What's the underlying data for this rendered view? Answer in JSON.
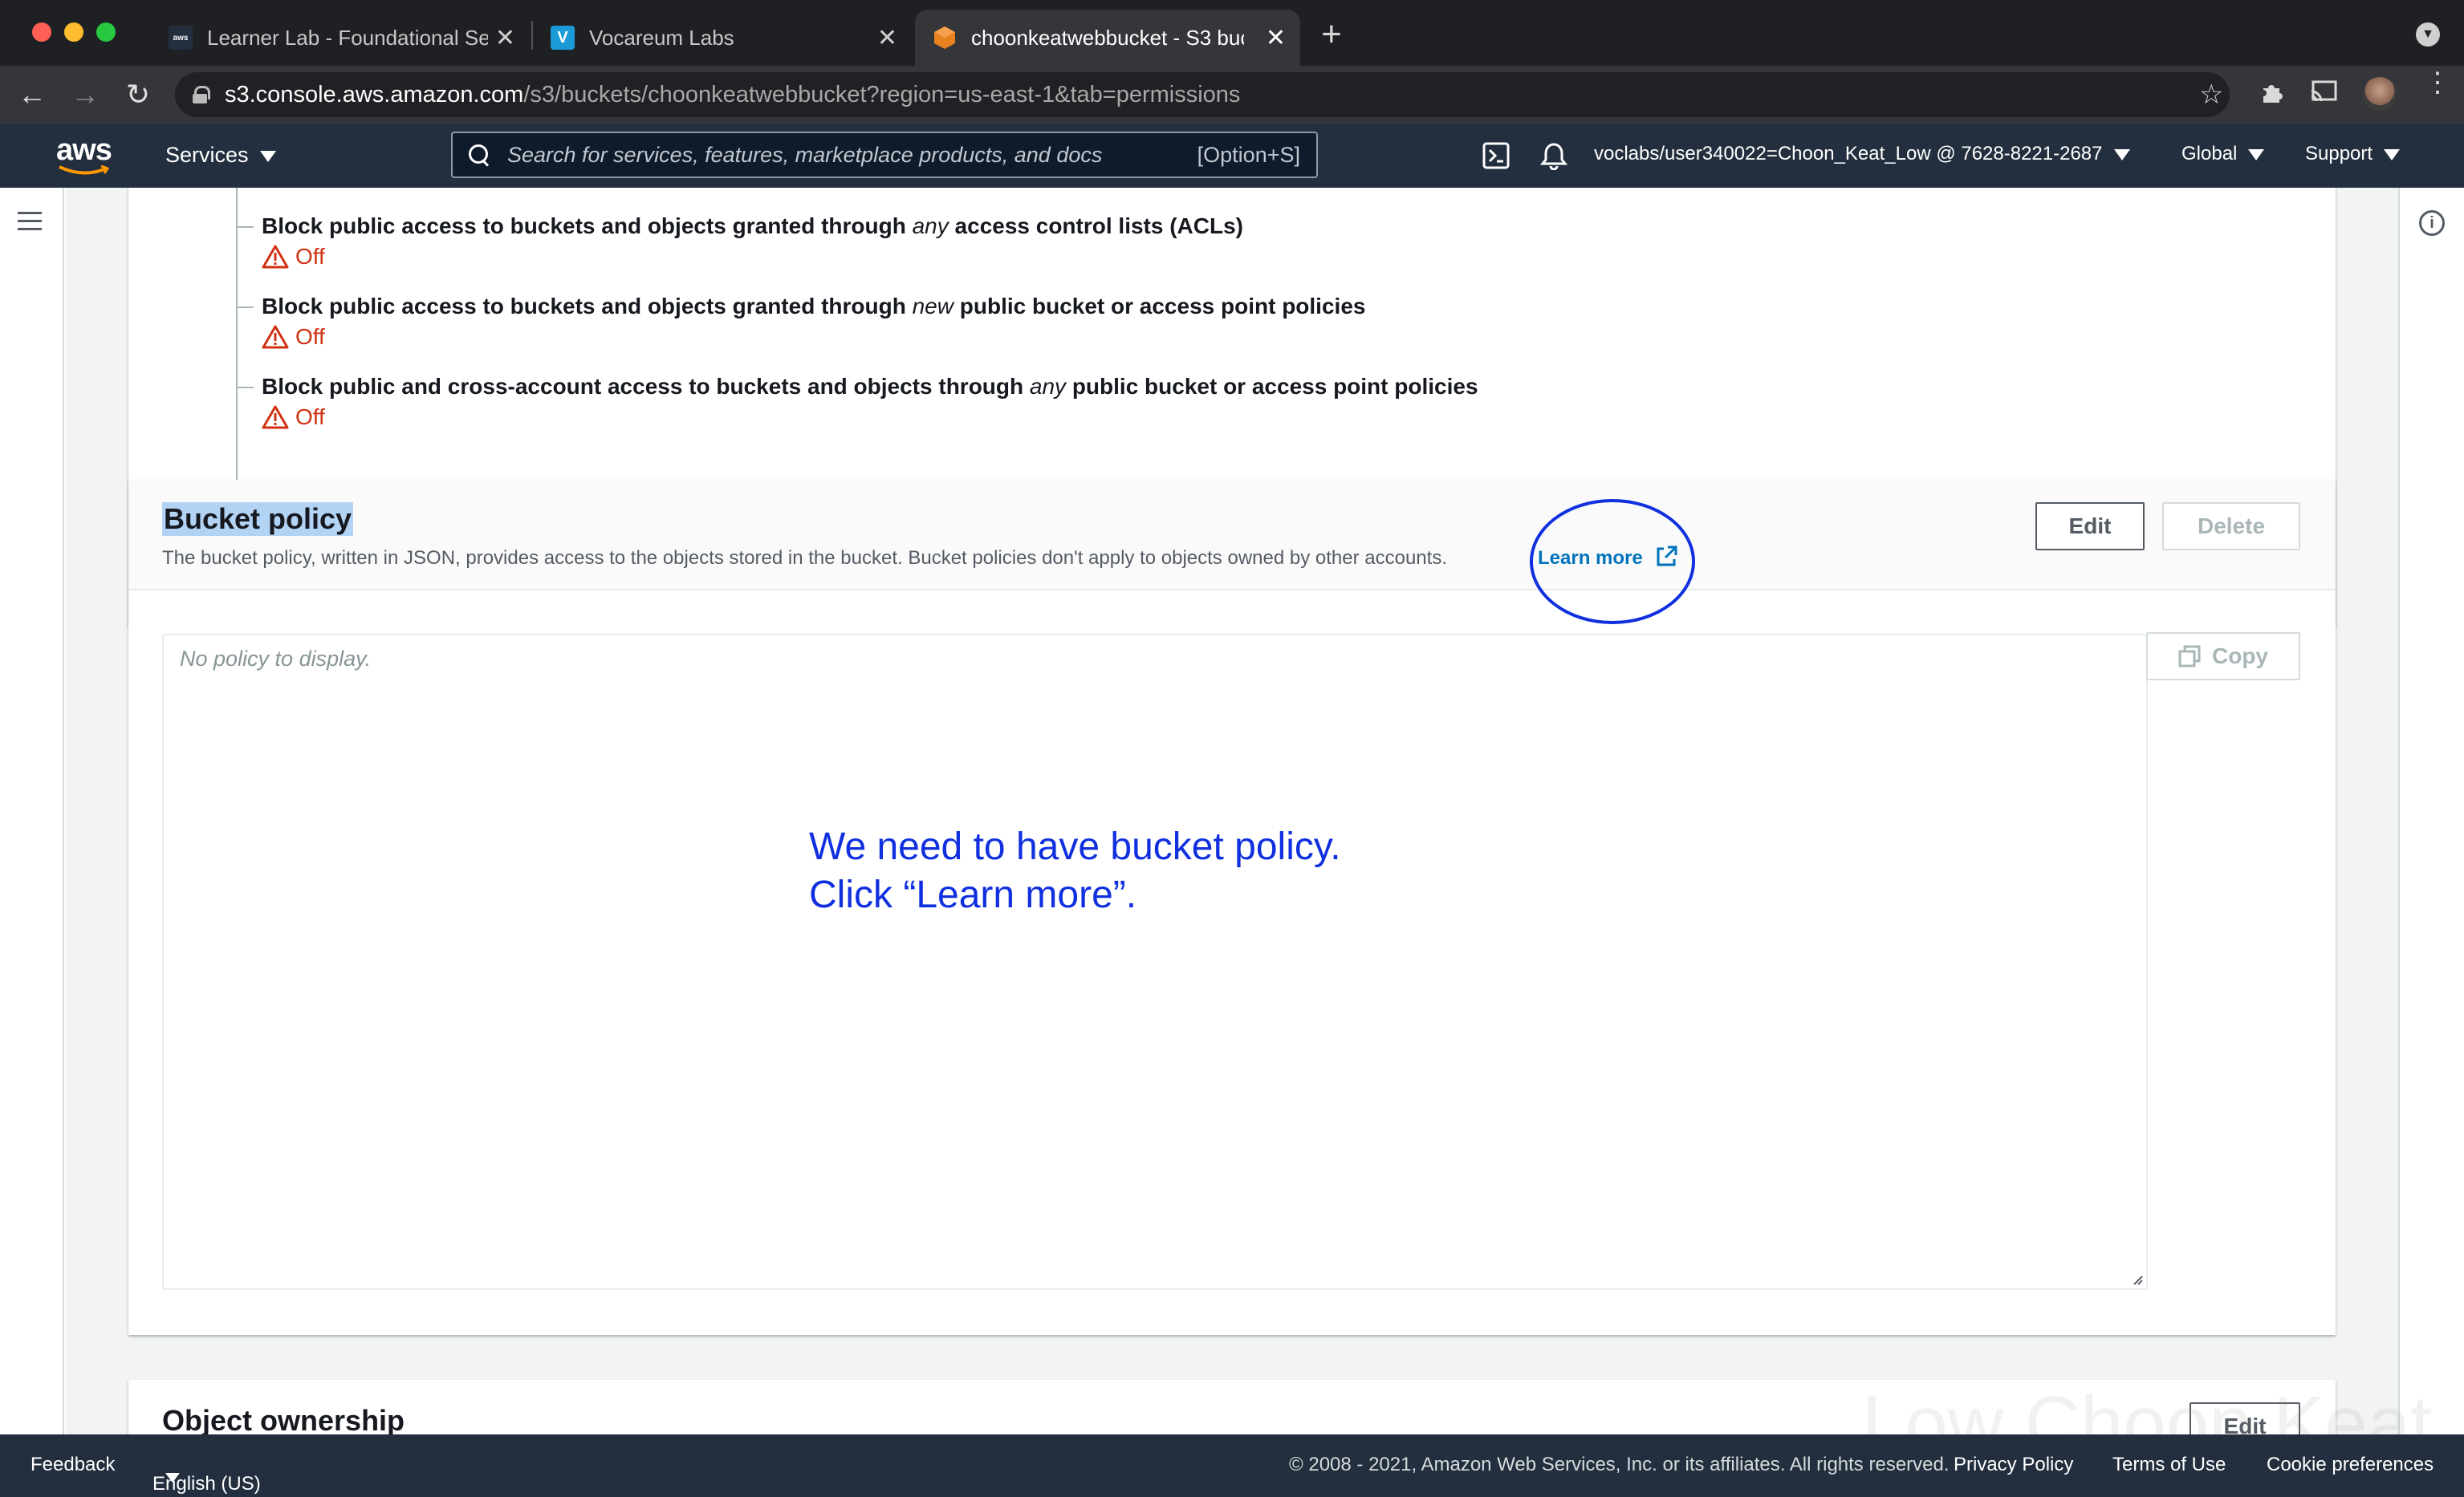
{
  "browser": {
    "tabs": [
      {
        "title": "Learner Lab - Foundational Ser",
        "favicon": "aws"
      },
      {
        "title": "Vocareum Labs",
        "favicon": "V"
      },
      {
        "title": "choonkeatwebbucket - S3 buc",
        "favicon": "s3"
      }
    ],
    "url_host": "s3.console.aws.amazon.com",
    "url_path": "/s3/buckets/choonkeatwebbucket?region=us-east-1&tab=permissions"
  },
  "aws_nav": {
    "logo": "aws",
    "services_label": "Services",
    "search_placeholder": "Search for services, features, marketplace products, and docs",
    "search_shortcut": "[Option+S]",
    "account": "voclabs/user340022=Choon_Keat_Low @ 7628-8221-2687",
    "region": "Global",
    "support": "Support"
  },
  "block_public_access": {
    "items": [
      {
        "pre": "Block public access to buckets and objects granted through ",
        "em": "any",
        "post": " access control lists (ACLs)",
        "status": "Off"
      },
      {
        "pre": "Block public access to buckets and objects granted through ",
        "em": "new",
        "post": " public bucket or access point policies",
        "status": "Off"
      },
      {
        "pre": "Block public and cross-account access to buckets and objects through ",
        "em": "any",
        "post": " public bucket or access point policies",
        "status": "Off"
      }
    ]
  },
  "bucket_policy": {
    "title": "Bucket policy",
    "description": "The bucket policy, written in JSON, provides access to the objects stored in the bucket. Bucket policies don't apply to objects owned by other accounts.",
    "learn_more": "Learn more",
    "edit_label": "Edit",
    "delete_label": "Delete",
    "copy_label": "Copy",
    "placeholder": "No policy to display.",
    "annotation_line1": "We need to have bucket policy.",
    "annotation_line2": "Click “Learn more”."
  },
  "object_ownership": {
    "title": "Object ownership",
    "edit_label": "Edit"
  },
  "footer": {
    "feedback": "Feedback",
    "language": "English (US)",
    "copyright": "© 2008 - 2021, Amazon Web Services, Inc. or its affiliates. All rights reserved.",
    "privacy": "Privacy Policy",
    "terms": "Terms of Use",
    "cookies": "Cookie preferences"
  },
  "watermark": "Low Choon Keat",
  "colors": {
    "aws_nav": "#232f3e",
    "status_off": "#d13212",
    "link": "#0073bb",
    "annotation": "#1030e0"
  }
}
